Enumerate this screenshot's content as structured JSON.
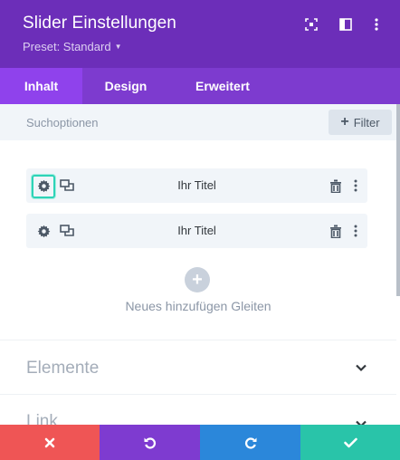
{
  "header": {
    "title": "Slider Einstellungen",
    "preset_label": "Preset: Standard",
    "icons": [
      "expand-icon",
      "split-view-icon",
      "more-icon"
    ],
    "bg_color": "#6c2eb9"
  },
  "tabs": [
    {
      "label": "Inhalt",
      "active": true
    },
    {
      "label": "Design",
      "active": false
    },
    {
      "label": "Erweitert",
      "active": false
    }
  ],
  "search": {
    "placeholder": "Suchoptionen",
    "filter_label": "Filter"
  },
  "items": [
    {
      "title": "Ihr Titel",
      "highlighted_icon": "gear-icon"
    },
    {
      "title": "Ihr Titel"
    }
  ],
  "add_item_label": "Neues hinzufügen Gleiten",
  "sections": [
    {
      "label": "Elemente",
      "expanded": false
    },
    {
      "label": "Link",
      "expanded": false
    }
  ],
  "footer": {
    "buttons": [
      {
        "action": "discard",
        "icon": "close-icon",
        "color": "#ef5555"
      },
      {
        "action": "undo",
        "icon": "undo-icon",
        "color": "#7e3bd0"
      },
      {
        "action": "redo",
        "icon": "redo-icon",
        "color": "#2b87da"
      },
      {
        "action": "save",
        "icon": "check-icon",
        "color": "#29c4a9"
      }
    ]
  }
}
